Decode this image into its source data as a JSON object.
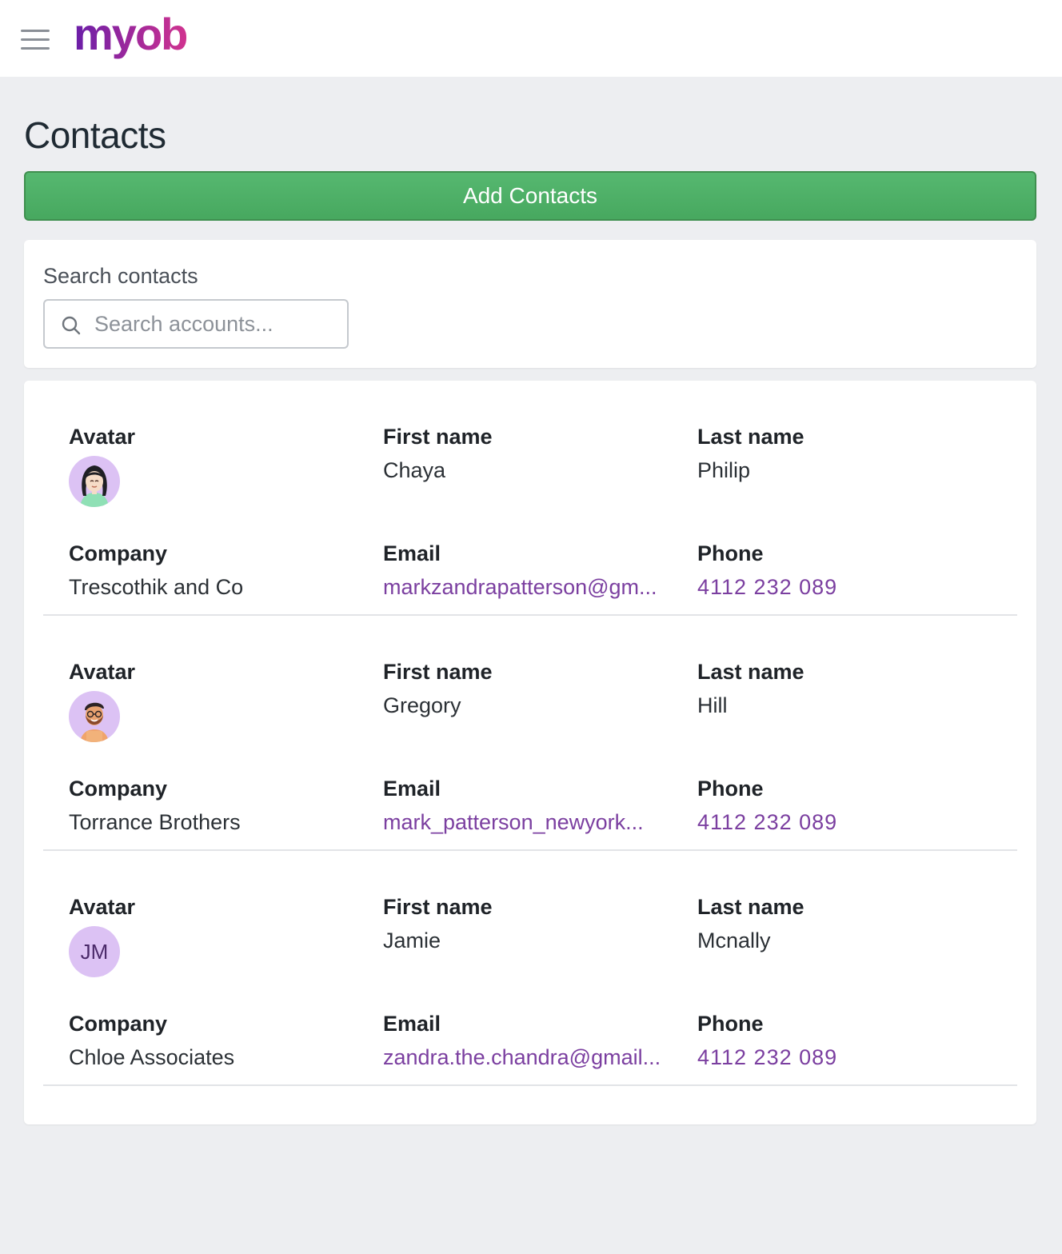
{
  "header": {
    "logo_text": "myob",
    "menu_icon": "hamburger-icon"
  },
  "page": {
    "title": "Contacts",
    "add_button_label": "Add Contacts"
  },
  "search": {
    "label": "Search contacts",
    "placeholder": "Search accounts...",
    "value": ""
  },
  "labels": {
    "avatar": "Avatar",
    "first_name": "First name",
    "last_name": "Last name",
    "company": "Company",
    "email": "Email",
    "phone": "Phone"
  },
  "colors": {
    "accent": "#7b3fa0",
    "button_green": "#4caf66",
    "avatar_bg": "#dcc2f4"
  },
  "contacts": [
    {
      "avatar": "woman-avatar-icon",
      "first_name": "Chaya",
      "last_name": "Philip",
      "company": "Trescothik and Co",
      "email": "markzandrapatterson@gm...",
      "phone": "4112 232 089"
    },
    {
      "avatar": "bearded-man-avatar-icon",
      "first_name": "Gregory",
      "last_name": "Hill",
      "company": "Torrance Brothers",
      "email": "mark_patterson_newyork...",
      "phone": "4112 232 089"
    },
    {
      "avatar_initials": "JM",
      "first_name": "Jamie",
      "last_name": "Mcnally",
      "company": "Chloe Associates",
      "email": "zandra.the.chandra@gmail...",
      "phone": "4112 232 089"
    }
  ]
}
